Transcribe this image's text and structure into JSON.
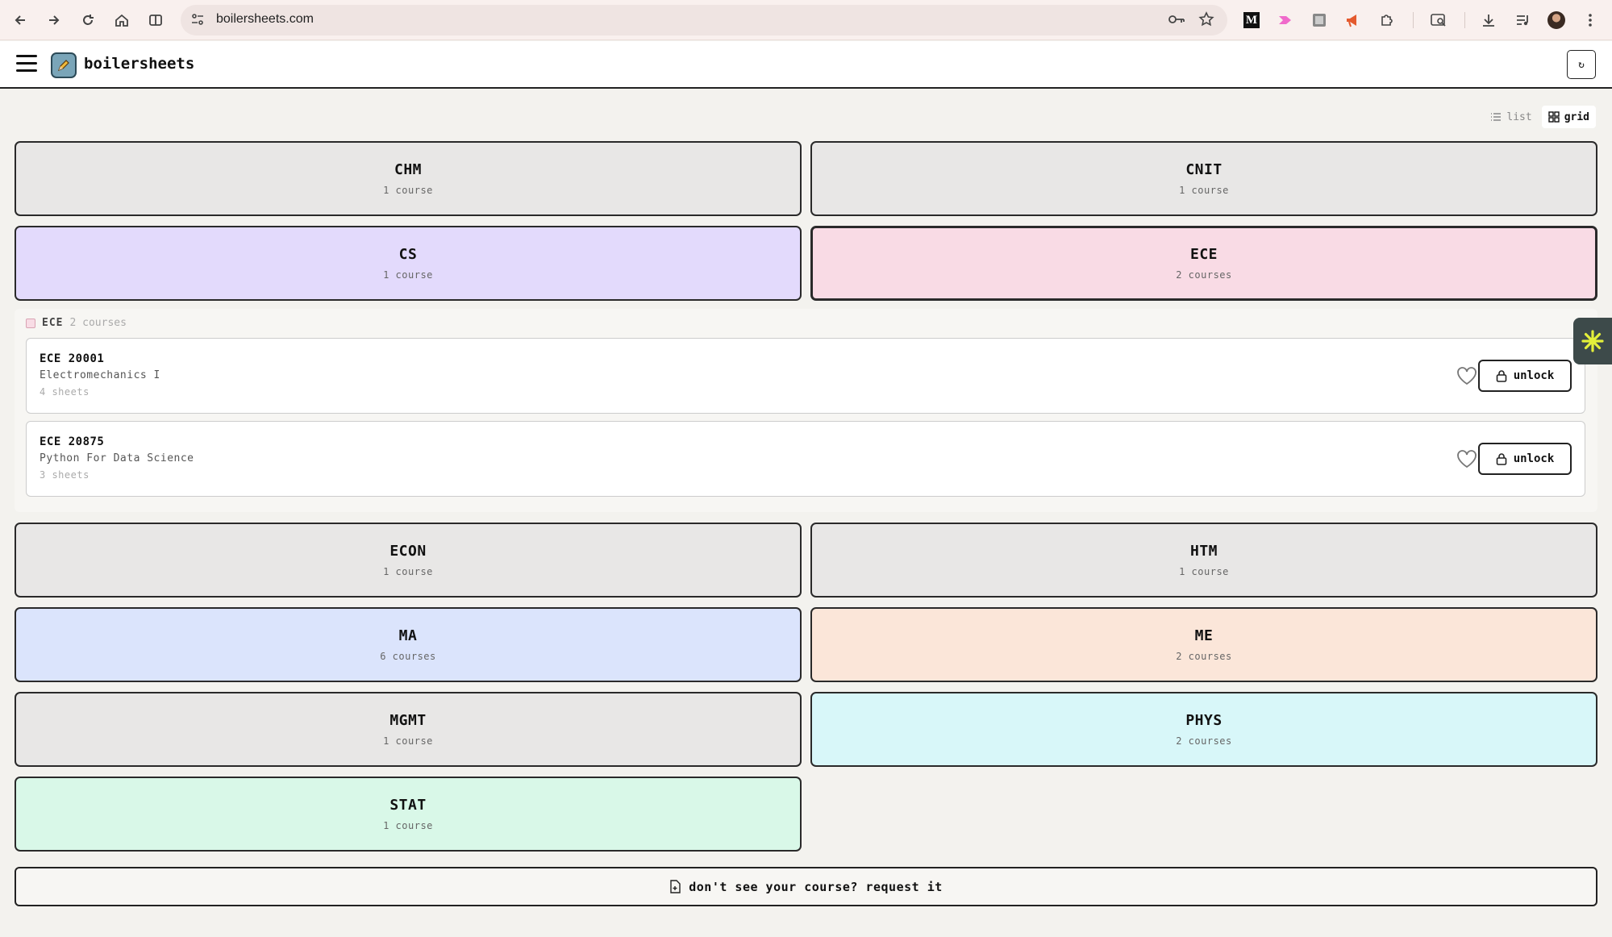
{
  "browser": {
    "url": "boilersheets.com"
  },
  "app": {
    "brand": "boilersheets",
    "refresh_label": "↻"
  },
  "view_toggle": {
    "list_label": "list",
    "grid_label": "grid",
    "active": "grid"
  },
  "subjects": [
    {
      "code": "CHM",
      "count": "1 course",
      "color": "#e8e7e6"
    },
    {
      "code": "CNIT",
      "count": "1 course",
      "color": "#e8e7e6"
    },
    {
      "code": "CS",
      "count": "1 course",
      "color": "#e3dafc"
    },
    {
      "code": "ECE",
      "count": "2 courses",
      "color": "#f9dbe5"
    },
    {
      "code": "ECON",
      "count": "1 course",
      "color": "#e8e7e6"
    },
    {
      "code": "HTM",
      "count": "1 course",
      "color": "#e8e7e6"
    },
    {
      "code": "MA",
      "count": "6 courses",
      "color": "#dbe4fc"
    },
    {
      "code": "ME",
      "count": "2 courses",
      "color": "#fbe6d9"
    },
    {
      "code": "MGMT",
      "count": "1 course",
      "color": "#e8e7e6"
    },
    {
      "code": "PHYS",
      "count": "2 courses",
      "color": "#d8f7f9"
    },
    {
      "code": "STAT",
      "count": "1 course",
      "color": "#d9f8e8"
    }
  ],
  "expanded": {
    "code": "ECE",
    "count": "2 courses",
    "courses": [
      {
        "code": "ECE 20001",
        "name": "Electromechanics I",
        "sheets": "4 sheets",
        "action": "unlock"
      },
      {
        "code": "ECE 20875",
        "name": "Python For Data Science",
        "sheets": "3 sheets",
        "action": "unlock"
      }
    ]
  },
  "request": {
    "label": "don't see your course? request it"
  }
}
